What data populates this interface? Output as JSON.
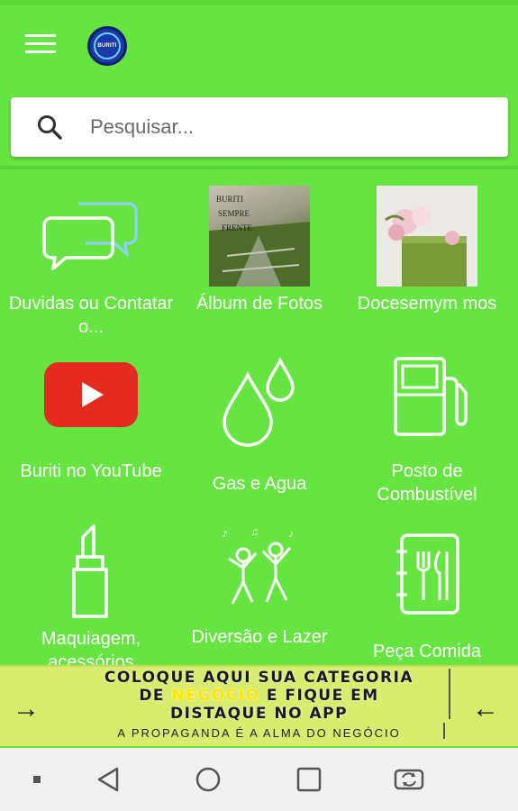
{
  "header": {
    "menu_icon": "hamburger-menu-icon",
    "logo_text": "BURITI"
  },
  "search": {
    "placeholder": "Pesquisar..."
  },
  "tiles": [
    {
      "label": "Duvidas ou Contatar o...",
      "icon": "chat-bubbles-icon"
    },
    {
      "label": "Álbum de Fotos",
      "icon": "photo-album-thumbnail"
    },
    {
      "label": "Docesemym mos",
      "icon": "cake-thumbnail"
    },
    {
      "label": "Buriti no YouTube",
      "icon": "youtube-icon"
    },
    {
      "label": "Gas e Agua",
      "icon": "water-drops-icon"
    },
    {
      "label": "Posto de Combustível",
      "icon": "fuel-pump-icon"
    },
    {
      "label": "Maquiagem, acessórios",
      "icon": "lipstick-icon"
    },
    {
      "label": "Diversão e Lazer",
      "icon": "dancing-people-icon"
    },
    {
      "label": "Peça Comida",
      "icon": "menu-book-icon"
    }
  ],
  "banner": {
    "line1": "COLOQUE AQUI  SUA CATEGORIA",
    "line2_pre": "DE ",
    "line2_highlight": "NEGÓCIO",
    "line2_post": " E FIQUE EM",
    "line3": "DISTAQUE NO APP",
    "slogan": "A PROPAGANDA É A ALMA DO NEGÓCIO",
    "left_arrow": "→",
    "right_arrow": "←"
  },
  "colors": {
    "background": "#66e542",
    "banner": "#d8ec6e",
    "navbar": "#f1f1f1"
  },
  "navbar": {
    "items": [
      "square-dot-icon",
      "back-icon",
      "home-icon",
      "recents-icon",
      "rotate-icon"
    ]
  }
}
